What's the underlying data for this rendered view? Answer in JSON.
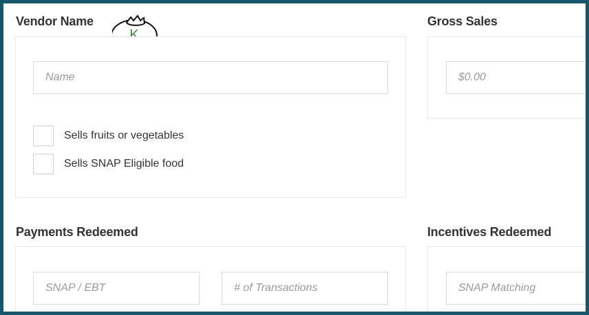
{
  "vendor": {
    "title": "Vendor Name",
    "name_placeholder": "Name",
    "checkbox_fruits_label": "Sells fruits or vegetables",
    "checkbox_snap_label": "Sells SNAP Eligible food"
  },
  "gross_sales": {
    "title": "Gross Sales",
    "placeholder": "$0.00"
  },
  "payments": {
    "title": "Payments Redeemed",
    "snap_placeholder": "SNAP / EBT",
    "transactions_placeholder": "# of Transactions"
  },
  "incentives": {
    "title": "Incentives Redeemed",
    "snap_matching_placeholder": "SNAP Matching"
  },
  "logo": {
    "letter": "K",
    "icon": "tomato-icon"
  },
  "colors": {
    "frame_border": "#17566b",
    "logo_letter": "#3f8c3f"
  }
}
